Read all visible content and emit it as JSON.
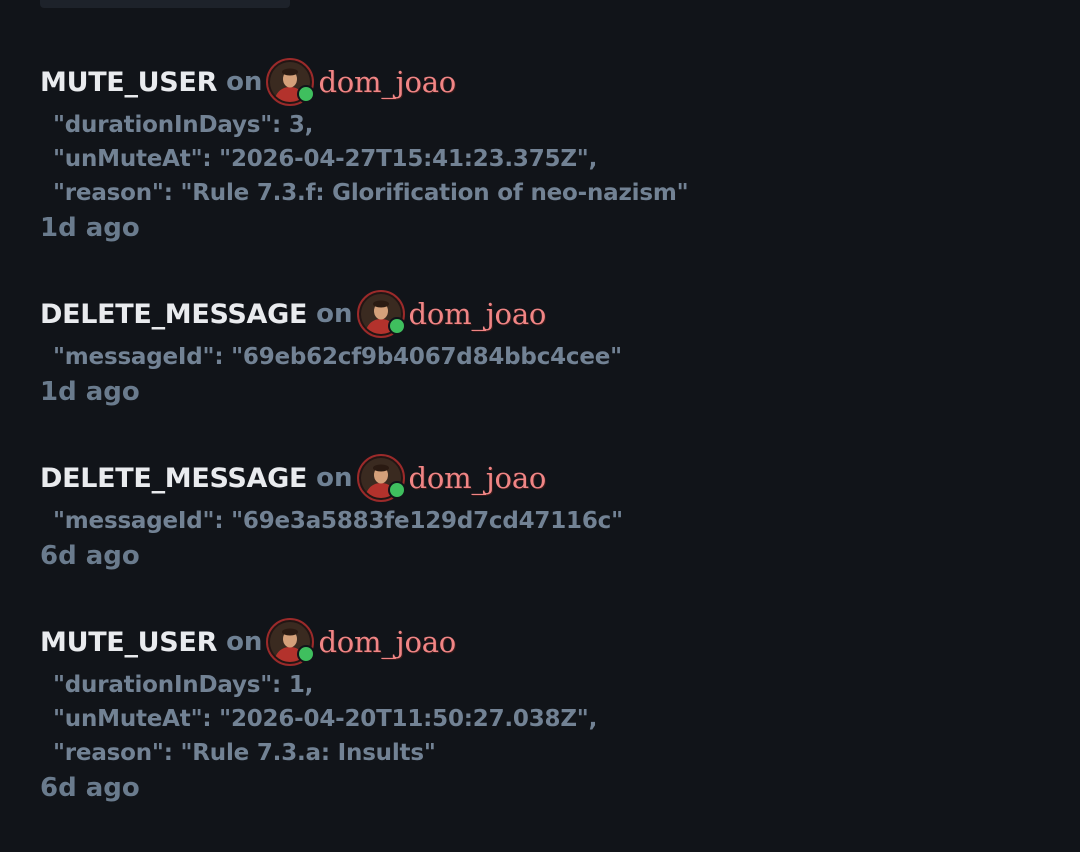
{
  "entries": [
    {
      "action": "MUTE_USER",
      "on_label": "on",
      "user": "dom_joao",
      "details": [
        "\"durationInDays\": 3,",
        "\"unMuteAt\": \"2026-04-27T15:41:23.375Z\",",
        "\"reason\": \"Rule 7.3.f: Glorification of neo-nazism\""
      ],
      "time": "1d ago"
    },
    {
      "action": "DELETE_MESSAGE",
      "on_label": "on",
      "user": "dom_joao",
      "details": [
        "\"messageId\": \"69eb62cf9b4067d84bbc4cee\""
      ],
      "time": "1d ago"
    },
    {
      "action": "DELETE_MESSAGE",
      "on_label": "on",
      "user": "dom_joao",
      "details": [
        "\"messageId\": \"69e3a5883fe129d7cd47116c\""
      ],
      "time": "6d ago"
    },
    {
      "action": "MUTE_USER",
      "on_label": "on",
      "user": "dom_joao",
      "details": [
        "\"durationInDays\": 1,",
        "\"unMuteAt\": \"2026-04-20T11:50:27.038Z\",",
        "\"reason\": \"Rule 7.3.a: Insults\""
      ],
      "time": "6d ago"
    }
  ],
  "colors": {
    "background": "#111419",
    "action_text": "#e9ebee",
    "muted_text": "#728294",
    "username": "#f08585",
    "avatar_ring": "#9b2a2a",
    "online_status": "#3fbf5e"
  },
  "icons": {
    "avatar": "user-avatar-portrait",
    "status": "online-status-dot"
  }
}
